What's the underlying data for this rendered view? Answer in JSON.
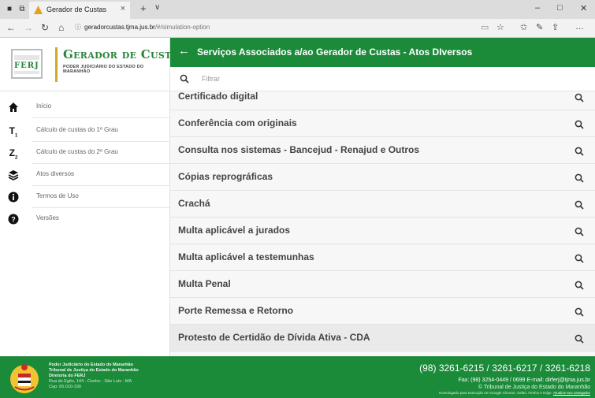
{
  "browser": {
    "tab_title": "Gerador de Custas",
    "url_host": "geradorcustas.tjma.jus.br",
    "url_path": "/#/simulation-option"
  },
  "brand": {
    "logo_text": "FERJ",
    "title": "Gerador de Custas",
    "subtitle": "PODER JUDICIÁRIO DO ESTADO DO MARANHÃO"
  },
  "sidebar": {
    "items": [
      {
        "label": "Início",
        "icon": "home-icon"
      },
      {
        "label": "Cálculo de custas do 1º Grau",
        "icon": "first-degree-icon"
      },
      {
        "label": "Cálculo de custas do 2º Grau",
        "icon": "second-degree-icon"
      },
      {
        "label": "Atos diversos",
        "icon": "layers-icon"
      },
      {
        "label": "Termos de Uso",
        "icon": "info-icon"
      },
      {
        "label": "Versões",
        "icon": "help-icon"
      }
    ]
  },
  "content": {
    "title": "Serviços Associados a/ao Gerador de Custas - Atos DIversos",
    "filter_placeholder": "Filtrar",
    "items": [
      {
        "label": "Certificado digital"
      },
      {
        "label": "Conferência com originais"
      },
      {
        "label": "Consulta nos sistemas - Bancejud - Renajud e Outros"
      },
      {
        "label": "Cópias reprográficas"
      },
      {
        "label": "Crachá"
      },
      {
        "label": "Multa aplicável a jurados"
      },
      {
        "label": "Multa aplicável a testemunhas"
      },
      {
        "label": "Multa Penal"
      },
      {
        "label": "Porte Remessa e Retorno"
      },
      {
        "label": "Protesto de Certidão de Dívida Ativa - CDA"
      }
    ]
  },
  "footer": {
    "left_lines": [
      "Poder Judiciário do Estado do Maranhão",
      "Tribunal de Justiça do Estado do Maranhão",
      "Diretoria do FERJ",
      "Rua do Egito, 144 - Centro - São Luís - MA",
      "Cep: 65.010-190"
    ],
    "phones": "(98) 3261-6215 / 3261-6217 / 3261-6218",
    "fax": "Fax: (98) 3254-0449 / 0699 E-mail: dirferj@tjma.jus.br",
    "copyright": "© Tribunal de Justiça do Estado do Maranhão",
    "homologation": "Homologado para execução em Google Chrome, Safari, Firefox e Edge.",
    "update_link": "Atualize seu navegador"
  },
  "colors": {
    "primary_green": "#1b8b3a",
    "gold": "#d0aa2a"
  }
}
